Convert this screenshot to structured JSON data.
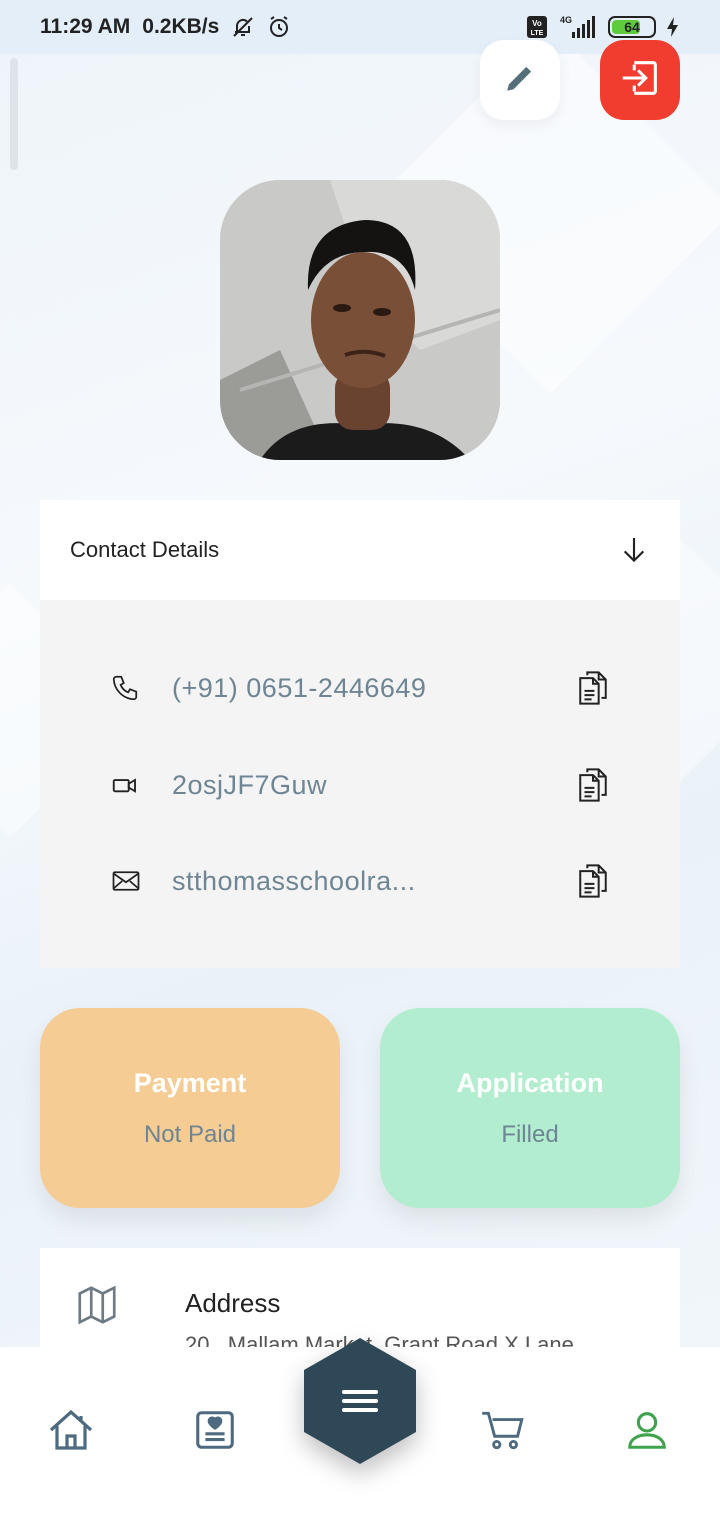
{
  "status_bar": {
    "time": "11:29 AM",
    "speed": "0.2KB/s",
    "network": "4G",
    "battery": "64"
  },
  "header": {
    "edit_icon": "pencil-icon",
    "logout_icon": "logout-icon",
    "logout_color": "#f03d2f"
  },
  "contact": {
    "title": "Contact Details",
    "phone": "(+91) 0651-2446649",
    "video_id": "2osjJF7Guw",
    "email": "stthomasschoolra..."
  },
  "payment": {
    "title": "Payment",
    "value": "Not Paid",
    "color": "#f5cc94"
  },
  "application": {
    "title": "Application",
    "value": "Filled",
    "color": "#b3edcf"
  },
  "address": {
    "label": "Address",
    "value": "20 , Mallam Market, Grant Road X Lane"
  },
  "bottom_nav": {
    "items": [
      "home-icon",
      "id-card-icon",
      "menu-icon",
      "cart-icon",
      "profile-icon"
    ],
    "active": "profile-icon",
    "active_color": "#3fa34d"
  }
}
